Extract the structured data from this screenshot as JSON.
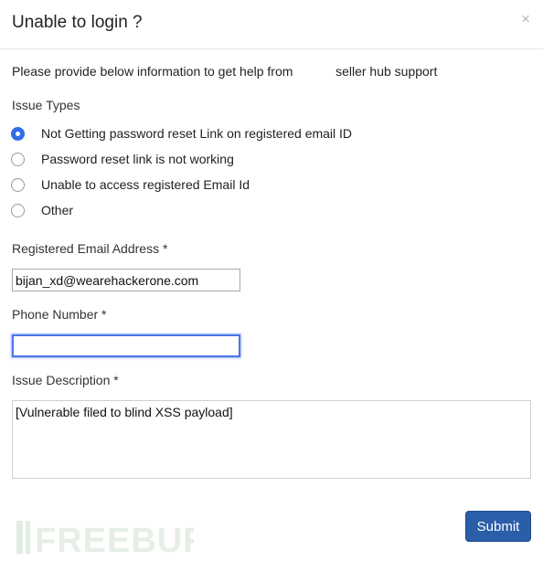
{
  "modal": {
    "title": "Unable to login ?",
    "close_glyph": "×",
    "intro_text": "Please provide below information to get help from            seller hub support"
  },
  "issue_types": {
    "label": "Issue Types",
    "options": [
      {
        "label": "Not Getting password reset Link on registered email ID",
        "checked": true
      },
      {
        "label": "Password reset link is not working",
        "checked": false
      },
      {
        "label": "Unable to access registered Email Id",
        "checked": false
      },
      {
        "label": "Other",
        "checked": false
      }
    ]
  },
  "email": {
    "label": "Registered Email Address *",
    "value": "bijan_xd@wearehackerone.com"
  },
  "phone": {
    "label": "Phone Number *",
    "value": ""
  },
  "description": {
    "label": "Issue Description *",
    "value": "[Vulnerable filed to blind XSS payload]"
  },
  "submit_label": "Submit",
  "watermark": {
    "text": "FREEBUF",
    "icon": "freebuf-logo"
  },
  "colors": {
    "primary": "#2b5ea8",
    "radio_checked": "#2f6ee6",
    "focus": "#4a76e6"
  }
}
